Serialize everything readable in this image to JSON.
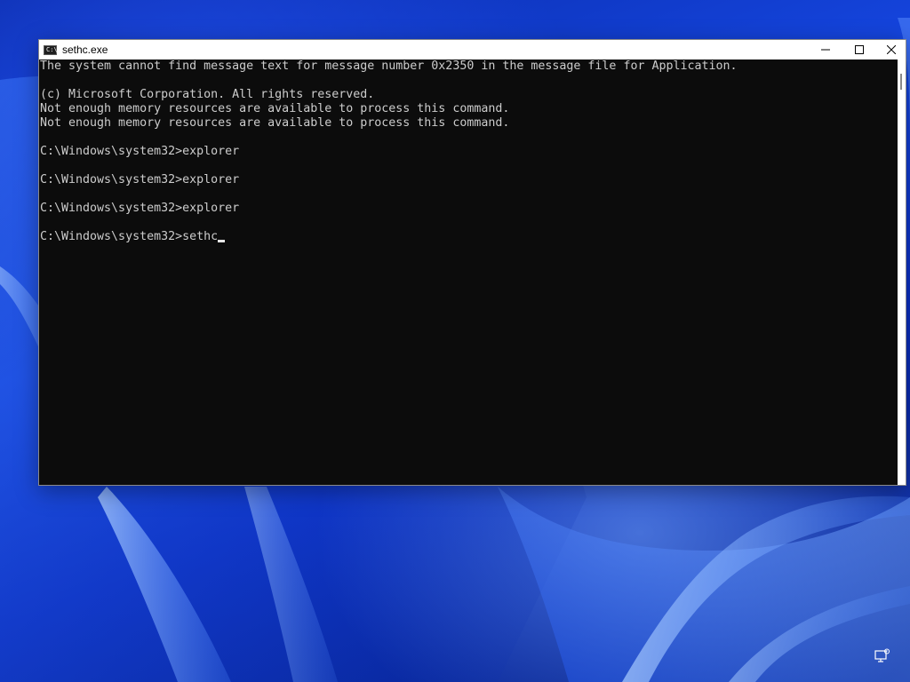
{
  "window": {
    "title": "sethc.exe",
    "icon": "cmd-icon"
  },
  "title_buttons": {
    "minimize_icon": "minimize-icon",
    "maximize_icon": "maximize-icon",
    "close_icon": "close-icon"
  },
  "console": {
    "lines": [
      "The system cannot find message text for message number 0x2350 in the message file for Application.",
      "",
      "(c) Microsoft Corporation. All rights reserved.",
      "Not enough memory resources are available to process this command.",
      "Not enough memory resources are available to process this command.",
      "",
      "C:\\Windows\\system32>explorer",
      "",
      "C:\\Windows\\system32>explorer",
      "",
      "C:\\Windows\\system32>explorer",
      "",
      "C:\\Windows\\system32>sethc"
    ],
    "text_color": "#cccccc",
    "background_color": "#0c0c0c"
  },
  "desktop": {
    "tray_icon": "network-icon"
  }
}
